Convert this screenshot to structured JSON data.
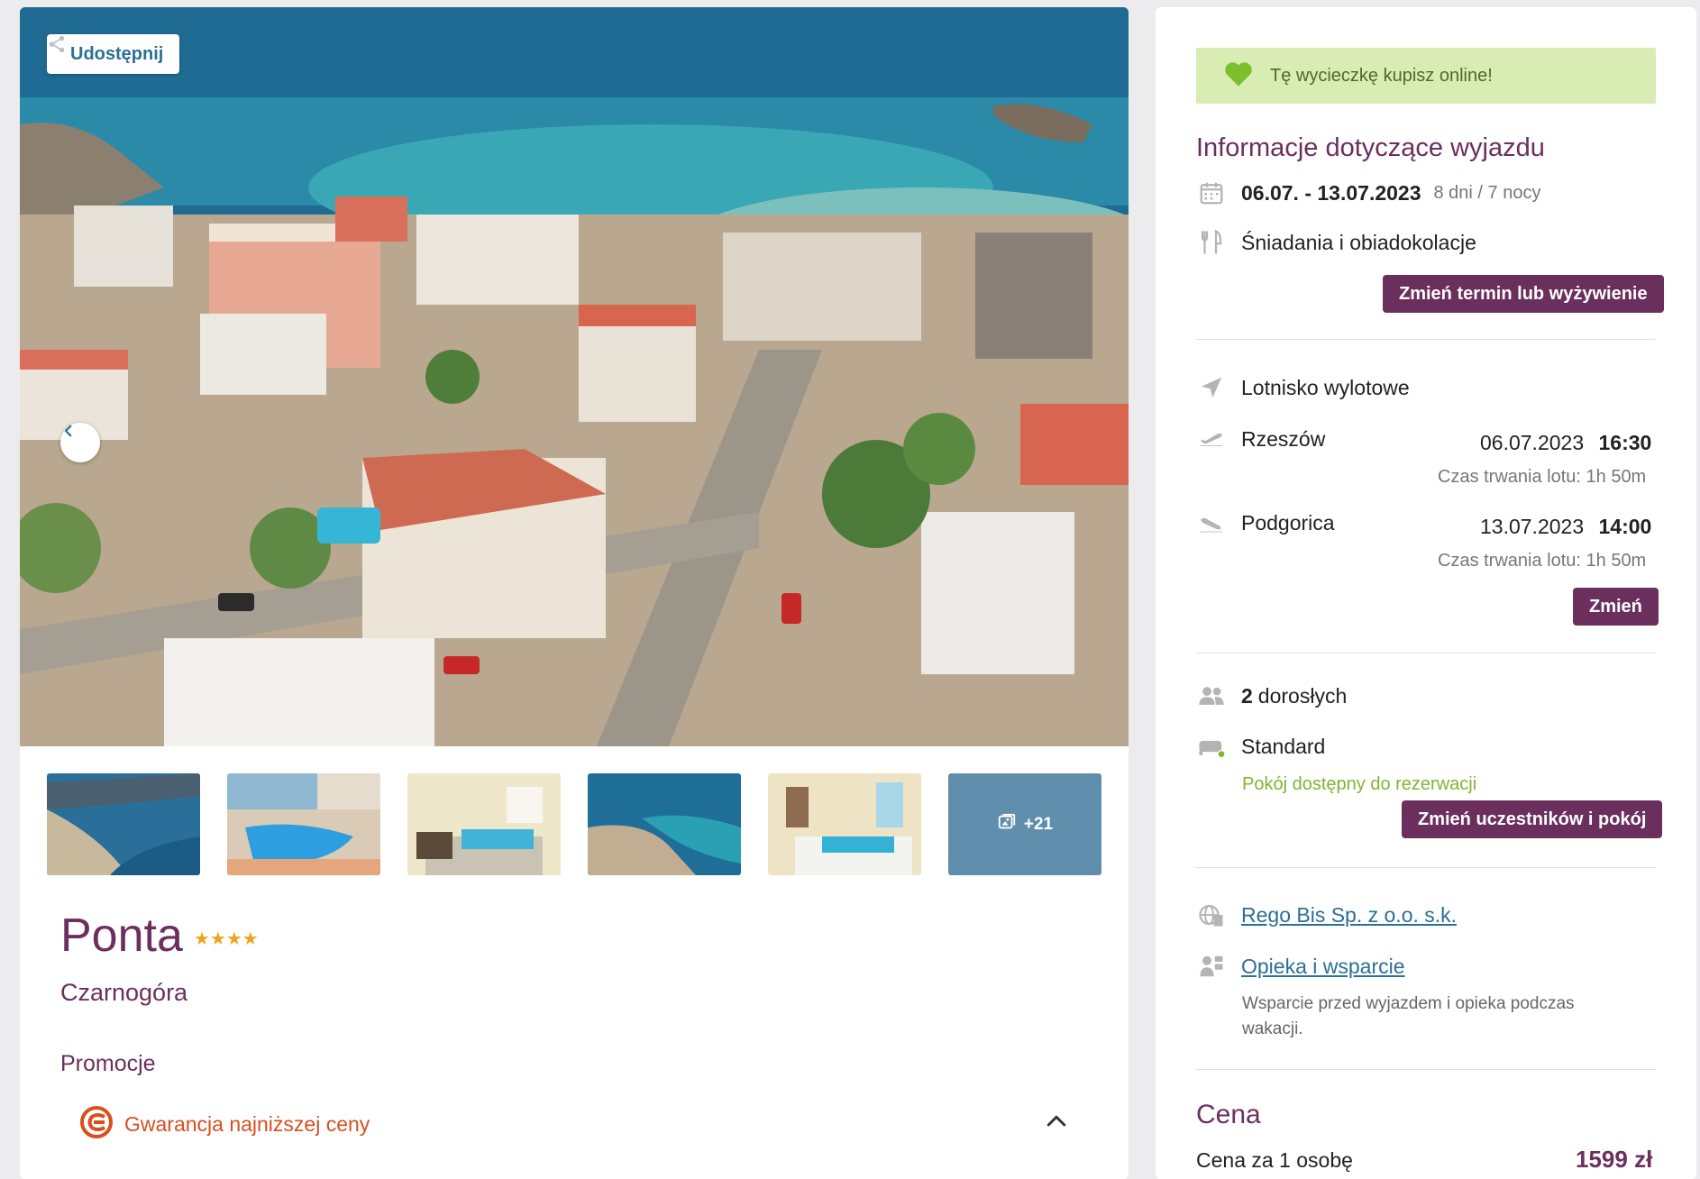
{
  "gallery": {
    "share_label": "Udostępnij",
    "more_count": "+21"
  },
  "hotel": {
    "name": "Ponta",
    "stars": "★★★★",
    "country": "Czarnogóra",
    "promotions_title": "Promocje",
    "guarantee_label": "Gwarancja najniższej ceny"
  },
  "sidebar": {
    "online_banner": "Tę wycieczkę kupisz online!",
    "section_title": "Informacje dotyczące wyjazdu",
    "dates": "06.07. - 13.07.2023",
    "duration": "8 dni / 7 nocy",
    "board": "Śniadania i obiadokolacje",
    "change_date_button": "Zmień termin lub wyżywienie",
    "departure_airport_label": "Lotnisko wylotowe",
    "flights": [
      {
        "city": "Rzeszów",
        "date": "06.07.2023",
        "time": "16:30",
        "duration": "Czas trwania lotu: 1h 50m"
      },
      {
        "city": "Podgorica",
        "date": "13.07.2023",
        "time": "14:00",
        "duration": "Czas trwania lotu: 1h 50m"
      }
    ],
    "change_flight_button": "Zmień",
    "participants_count": "2",
    "participants_label": "dorosłych",
    "room": "Standard",
    "room_available": "Pokój dostępny do rezerwacji",
    "change_participants_button": "Zmień uczestników i pokój",
    "organizer_link": "Rego Bis Sp. z o.o. s.k.",
    "support_link": "Opieka i wsparcie",
    "support_desc": "Wsparcie przed wyjazdem i opieka podczas wakacji.",
    "price_title": "Cena",
    "price_per_person_label": "Cena za 1 osobę",
    "price_per_person_value": "1599 zł"
  },
  "colors": {
    "brand_purple": "#6b2f5e",
    "link_blue": "#2c6f95",
    "success_green": "#83b335",
    "guarantee_orange": "#d94f1e",
    "star_gold": "#f0a41d"
  },
  "icons": [
    "share-icon",
    "chevron-left-icon",
    "gallery-icon",
    "lowest-price-guarantee-icon",
    "chevron-up-icon",
    "heart-icon",
    "calendar-icon",
    "fork-knife-icon",
    "navigation-arrow-icon",
    "plane-takeoff-icon",
    "plane-landing-icon",
    "people-icon",
    "bed-icon",
    "globe-building-icon",
    "support-agent-icon"
  ]
}
